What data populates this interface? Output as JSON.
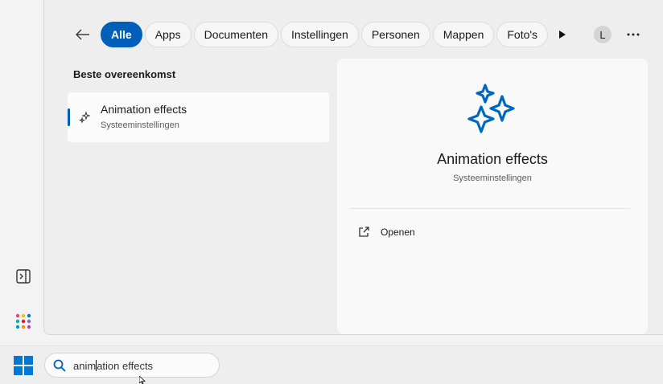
{
  "filters": {
    "back_label": "",
    "items": [
      "Alle",
      "Apps",
      "Documenten",
      "Instellingen",
      "Personen",
      "Mappen",
      "Foto's"
    ],
    "active": "Alle"
  },
  "account": {
    "initial": "L"
  },
  "best_match": {
    "heading": "Beste overeenkomst",
    "title": "Animation effects",
    "subtitle": "Systeeminstellingen"
  },
  "detail": {
    "title": "Animation effects",
    "subtitle": "Systeeminstellingen",
    "action_label": "Openen"
  },
  "taskbar": {
    "search_text_before_caret": "anim",
    "search_text_after_caret": "ation effects"
  },
  "colors": {
    "accent": "#005fb8",
    "icon_blue": "#0067c0"
  }
}
